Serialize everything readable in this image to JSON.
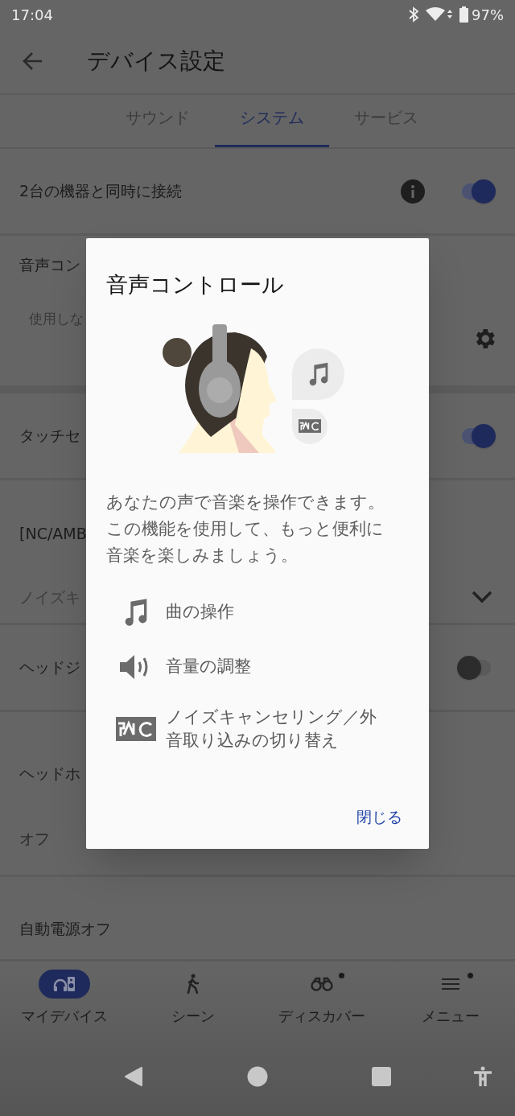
{
  "status_bar": {
    "time": "17:04",
    "battery": "97%"
  },
  "app_bar": {
    "title": "デバイス設定"
  },
  "tabs": [
    {
      "label": "サウンド",
      "selected": false
    },
    {
      "label": "システム",
      "selected": true
    },
    {
      "label": "サービス",
      "selected": false
    }
  ],
  "settings": [
    {
      "kind": "toggle",
      "label": "2台の機器と同時に接続",
      "info": true,
      "on": true
    },
    {
      "kind": "gear",
      "label": "音声コン",
      "value": "使用しな"
    },
    {
      "kind": "toggle",
      "label": "タッチセ",
      "on": true
    },
    {
      "kind": "dropdown",
      "label": "[NC/AMB",
      "value": "ノイズキ"
    },
    {
      "kind": "toggle",
      "label": "ヘッドジ",
      "on": false
    },
    {
      "kind": "value",
      "label": "ヘッドホ",
      "value": "オフ"
    },
    {
      "kind": "plain",
      "label": "自動電源オフ"
    }
  ],
  "dialog": {
    "title": "音声コントロール",
    "description": "あなたの声で音楽を操作できます。この機能を使用して、もっと便利に音楽を楽しみましょう。",
    "features": [
      {
        "kind": "music",
        "label": "曲の操作"
      },
      {
        "kind": "volume",
        "label": "音量の調整"
      },
      {
        "kind": "nc",
        "label": "ノイズキャンセリング／外音取り込みの切り替え"
      }
    ],
    "close": "閉じる"
  },
  "bottom_nav": [
    {
      "kind": "device",
      "label": "マイデバイス",
      "selected": true,
      "badge": false
    },
    {
      "kind": "scene",
      "label": "シーン",
      "selected": false,
      "badge": false
    },
    {
      "kind": "discover",
      "label": "ディスカバー",
      "selected": false,
      "badge": true
    },
    {
      "kind": "menu",
      "label": "メニュー",
      "selected": false,
      "badge": true
    }
  ]
}
